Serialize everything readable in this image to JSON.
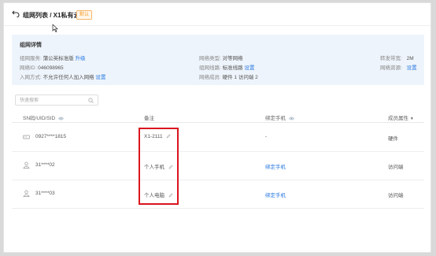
{
  "header": {
    "breadcrumb": "组网列表 / X1私有云",
    "badge": "默认"
  },
  "details": {
    "title": "组网详情",
    "service_label": "组网服务:",
    "service_value": "蒲公英标准版",
    "service_link": "升级",
    "network_type_label": "网络类型:",
    "network_type_value": "对等网络",
    "forward_bw_label": "转发带宽:",
    "forward_bw_value": "2M",
    "network_id_label": "网络ID:",
    "network_id_value": "046098965",
    "route_label": "组网线路:",
    "route_value": "标准线路",
    "route_link": "设置",
    "resource_label": "网络资源:",
    "resource_link": "设置",
    "join_label": "入网方式:",
    "join_value": "不允许任何人加入网络",
    "join_link": "设置",
    "members_label": "网络成员:",
    "members_value": "硬件 1  访问端 2"
  },
  "search": {
    "placeholder": "快速搜索"
  },
  "table": {
    "headers": {
      "sn": "SN码/UID/SID",
      "note": "备注",
      "bind": "绑定手机",
      "attr": "成员属性"
    },
    "rows": [
      {
        "icon": "router-icon",
        "sn": "0927****1815",
        "note": "X1-2111",
        "bind": "-",
        "attr": "硬件"
      },
      {
        "icon": "user-icon",
        "sn": "31****02",
        "note": "个人手机",
        "bind": "绑定手机",
        "attr": "访问端"
      },
      {
        "icon": "user-icon",
        "sn": "31****03",
        "note": "个人电脑",
        "bind": "绑定手机",
        "attr": "访问端"
      }
    ]
  },
  "colors": {
    "accent": "#2a7ae2",
    "highlight": "#d9151e",
    "badge": "#f59a23",
    "details_bg": "#eef4fb"
  }
}
